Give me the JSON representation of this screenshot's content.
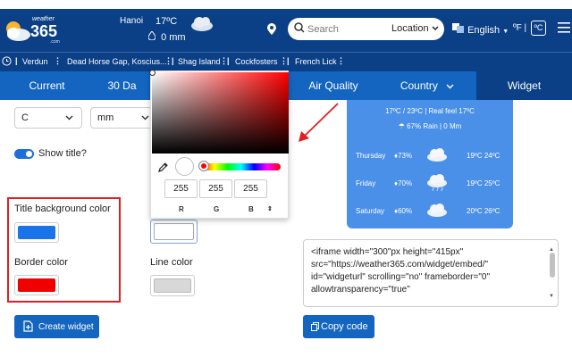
{
  "header": {
    "logo_small": "weather",
    "logo_num": "365",
    "logo_com": ".com",
    "city": "Hanoi",
    "temp": "17ºC",
    "rain": "0 mm",
    "search_placeholder": "Search",
    "location_select": "Location",
    "language": "English",
    "unit_f": "ºF",
    "unit_c": "ºC"
  },
  "locations": [
    "Verdun",
    "Dead Horse Gap, Koscius...",
    "Shag Island",
    "Cockfosters",
    "French Lick"
  ],
  "tabs": [
    {
      "label": "Current",
      "active": false
    },
    {
      "label": "30 Da",
      "active": false
    },
    {
      "label": "Air Quality",
      "active": false
    },
    {
      "label": "Country",
      "active": false
    },
    {
      "label": "Widget",
      "active": true
    }
  ],
  "form": {
    "temp_unit": "C",
    "rain_unit": "mm",
    "show_title_label": "Show title?",
    "show_title_on": true,
    "title_bg_label": "Title background color",
    "title_bg_color": "#1a73e8",
    "border_label": "Border color",
    "border_color": "#f00000",
    "line_color_label": "Line color",
    "line_color": "#d8d8d8",
    "create_button": "Create widget"
  },
  "picker": {
    "r": "255",
    "g": "255",
    "b": "255",
    "r_label": "R",
    "g_label": "G",
    "b_label": "B"
  },
  "widget": {
    "summary_temp": "17ºC / 23ºC | Real feel 17ºC",
    "summary_rain": "67% Rain | 0 Mm",
    "days": [
      {
        "day": "Thursday",
        "rain": "73%",
        "temp": "19ºC 24ºC"
      },
      {
        "day": "Friday",
        "rain": "70%",
        "temp": "19ºC 25ºC"
      },
      {
        "day": "Saturday",
        "rain": "60%",
        "temp": "20ºC 26ºC"
      }
    ]
  },
  "code": {
    "lines": [
      "<iframe width=\"300\"px height=\"415px\"",
      "src=\"https://weather365.com/widget/embed/\"",
      "id=\"widgeturl\" scrolling=\"no\" frameborder=\"0\"",
      "allowtransparency=\"true\""
    ],
    "copy_button": "Copy code"
  },
  "colors": {
    "header_bg": "#0b3f86",
    "tab_bg": "#1465bf",
    "accent_red": "#e02020"
  }
}
